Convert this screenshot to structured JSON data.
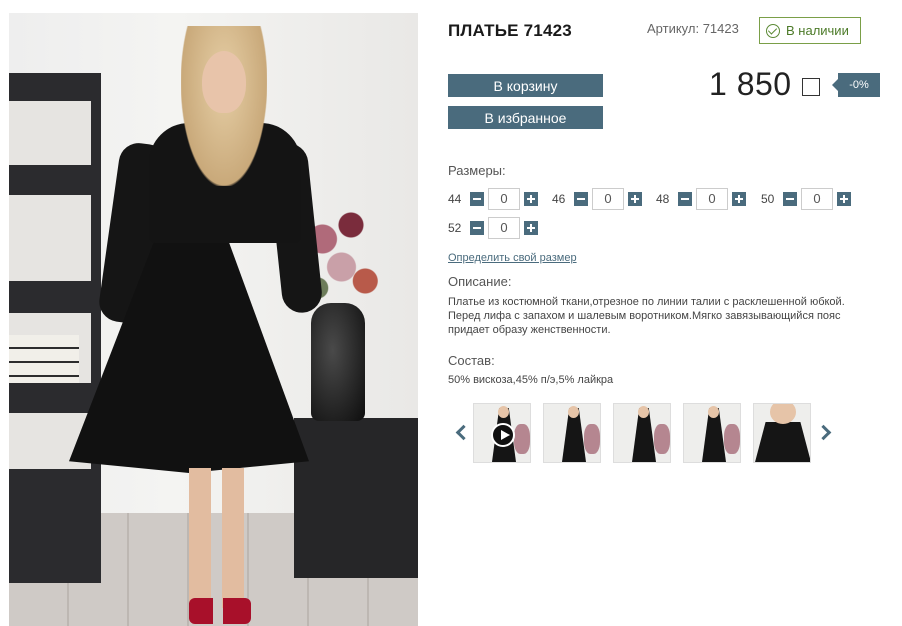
{
  "product": {
    "title": "ПЛАТЬЕ 71423",
    "article": "Артикул: 71423",
    "stock": "В наличии",
    "price": "1 850",
    "discount": "-0%"
  },
  "actions": {
    "cart_label": "В корзину",
    "favorite_label": "В избранное"
  },
  "sizes": {
    "label": "Размеры:",
    "items": [
      {
        "size": "44",
        "qty": "0"
      },
      {
        "size": "46",
        "qty": "0"
      },
      {
        "size": "48",
        "qty": "0"
      },
      {
        "size": "50",
        "qty": "0"
      },
      {
        "size": "52",
        "qty": "0"
      }
    ],
    "determine_link": "Определить свой размер"
  },
  "description": {
    "label": "Описание:",
    "text": "Платье из костюмной ткани,отрезное по линии талии с расклешенной юбкой. Перед лифа с запахом и шалевым воротником.Мягко завязывающийся пояс придает образу женственности."
  },
  "composition": {
    "label": "Состав:",
    "text": "50% вискоза,45% п/э,5% лайкра"
  },
  "gallery": {
    "thumbnails": [
      "video",
      "photo",
      "photo",
      "photo",
      "closeup"
    ]
  },
  "colors": {
    "accent": "#4a6b7d",
    "stock_green": "#5c8a36",
    "shoe_red": "#a8102a"
  }
}
